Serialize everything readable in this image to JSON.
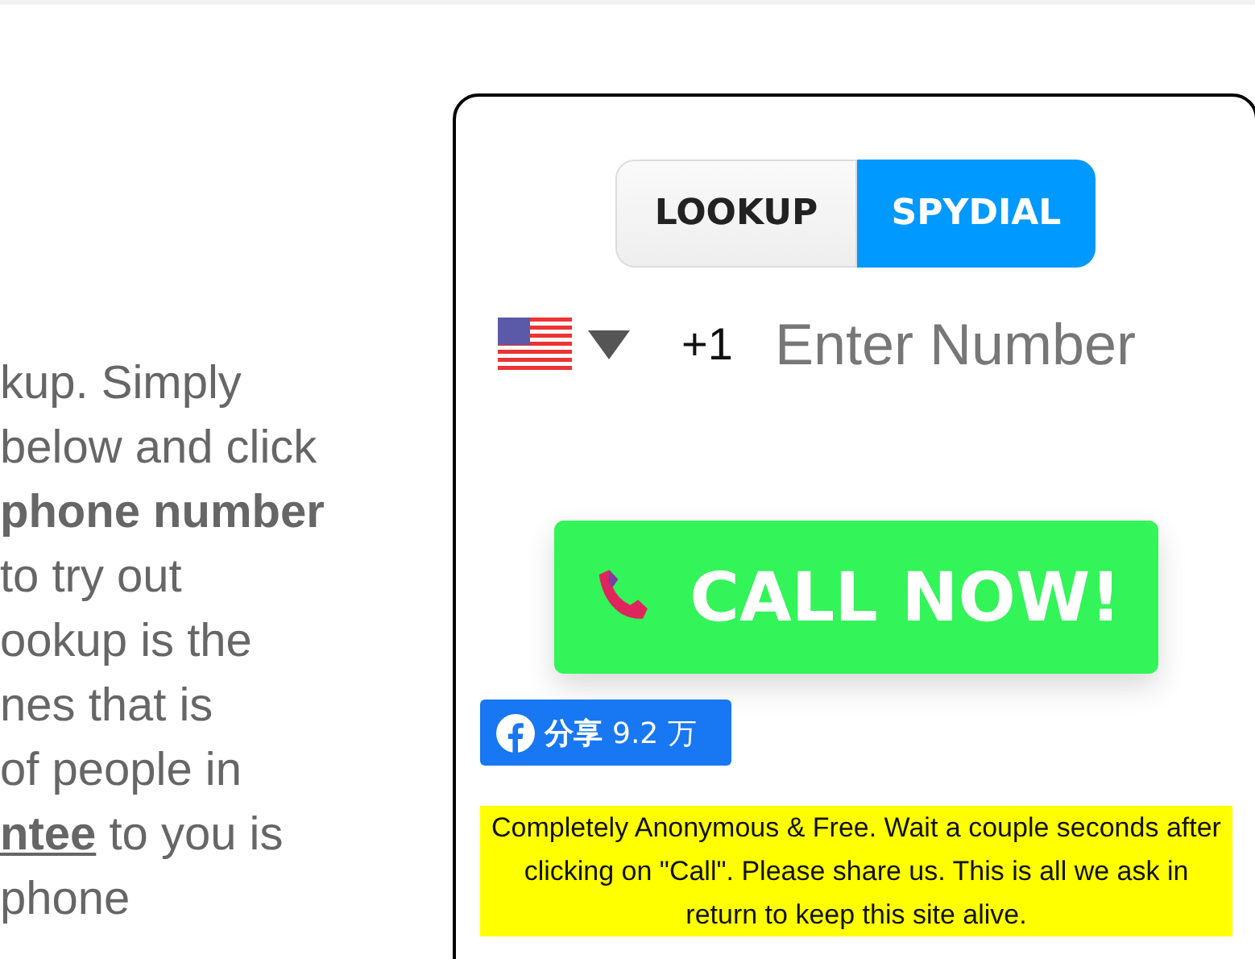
{
  "intro": {
    "lines": [
      {
        "segments": [
          {
            "text": "kup. Simply",
            "kind": "plain"
          }
        ]
      },
      {
        "segments": [
          {
            "text": "below and click",
            "kind": "plain"
          }
        ]
      },
      {
        "segments": [
          {
            "text": "phone number",
            "kind": "bold"
          }
        ]
      },
      {
        "segments": [
          {
            "text": " to try out",
            "kind": "plain"
          }
        ]
      },
      {
        "segments": [
          {
            "text": "ookup is the",
            "kind": "plain"
          }
        ]
      },
      {
        "segments": [
          {
            "text": "nes that is",
            "kind": "plain"
          }
        ]
      },
      {
        "segments": [
          {
            "text": "of people in",
            "kind": "plain"
          }
        ]
      },
      {
        "segments": [
          {
            "text": "ntee",
            "kind": "link"
          },
          {
            "text": " to you is",
            "kind": "plain"
          }
        ]
      },
      {
        "segments": [
          {
            "text": "phone",
            "kind": "plain"
          }
        ]
      }
    ]
  },
  "tabs": [
    {
      "label": "LOOKUP",
      "selected": false
    },
    {
      "label": "SPYDIAL",
      "selected": true
    }
  ],
  "phone": {
    "country_code": "+1",
    "placeholder": "Enter Number"
  },
  "call_button": {
    "label": "CALL NOW!"
  },
  "share": {
    "label": "分享",
    "count": "9.2 万"
  },
  "notice": "Completely Anonymous & Free. Wait a couple seconds after clicking on \"Call\". Please share us. This is all we ask in return to keep this site alive."
}
